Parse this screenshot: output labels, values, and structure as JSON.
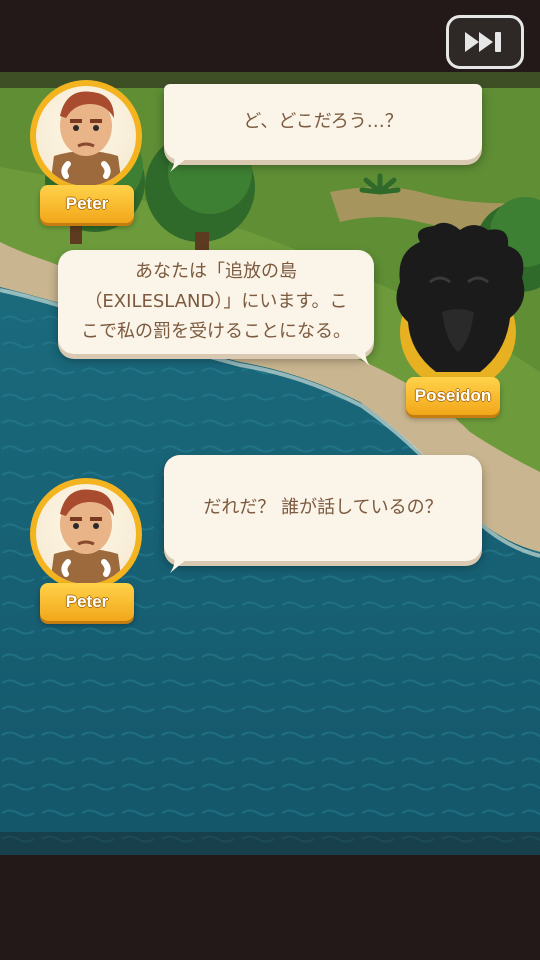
{
  "dialogue": [
    {
      "speaker": "Peter",
      "text": "ど、どこだろう…？"
    },
    {
      "speaker": "Poseidon",
      "text": "あなたは「追放の島\n（EXILESLAND）」にいます。こ\nこで私の罰を受けることになる。"
    },
    {
      "speaker": "Peter",
      "text": "だれだ？ 誰が話しているの？"
    }
  ],
  "controls": {
    "skip_icon": "fast-forward-icon"
  },
  "colors": {
    "bubble": "#fbf4e8",
    "bubble_text": "#7b5a3f",
    "name_plate": "#f7b825",
    "portrait_ring": "#f4b41f",
    "sea": "#1b6d80",
    "background": "#231a19"
  }
}
